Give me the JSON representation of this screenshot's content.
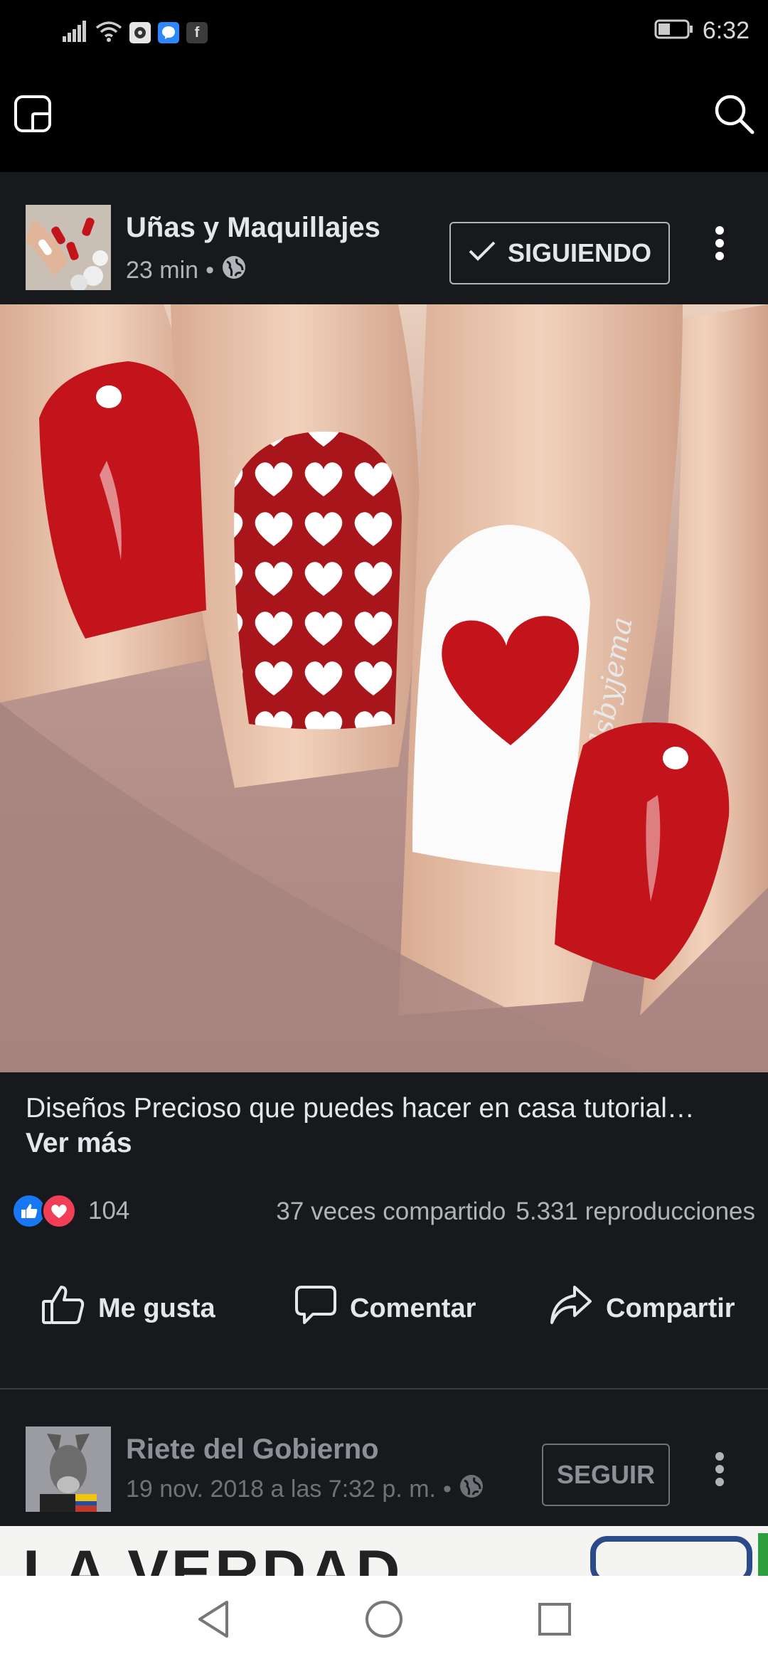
{
  "status_bar": {
    "time": "6:32",
    "app_icons": [
      "wifi-settings-icon",
      "messenger-icon",
      "facebook-icon"
    ]
  },
  "top_bar": {
    "left_icon": "tab-switch-icon",
    "right_icon": "search-icon"
  },
  "post": {
    "page_name": "Uñas y Maquillajes",
    "time_ago": "23 min",
    "separator": "•",
    "follow_label": "SIGUIENDO",
    "image_watermark": "@nailsbyjema",
    "caption": "Diseños Precioso que puedes hacer en casa tutorial…",
    "see_more": "Ver más",
    "reaction_count": "104",
    "shares": "37 veces compartido",
    "views": "5.331 reproducciones",
    "actions": {
      "like": "Me gusta",
      "comment": "Comentar",
      "share": "Compartir"
    }
  },
  "next_post": {
    "page_name": "Riete del Gobierno",
    "timestamp": "19 nov. 2018 a las 7:32 p. m.",
    "separator": "•",
    "follow_label": "SEGUIR",
    "preview_text": "LA VERDAD"
  },
  "colors": {
    "like_blue": "#1877f2",
    "love_red": "#f33e58",
    "nail_red": "#c4141b",
    "background": "#18191c"
  }
}
